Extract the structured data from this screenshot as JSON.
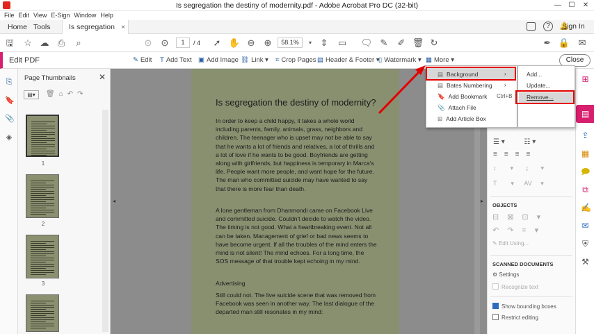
{
  "window": {
    "title": "Is segregation the destiny of modernity.pdf - Adobe Acrobat Pro DC (32-bit)",
    "minimize": "—",
    "maximize": "☐",
    "close": "✕"
  },
  "menu": [
    "File",
    "Edit",
    "View",
    "E-Sign",
    "Window",
    "Help"
  ],
  "tabs": {
    "home": "Home",
    "tools": "Tools",
    "doc": "Is segregation the ...",
    "doc_close": "×",
    "sign_in": "Sign In"
  },
  "toolbar": {
    "page_current": "1",
    "page_total": "/ 4",
    "zoom": "58.1%"
  },
  "editbar": {
    "label": "Edit PDF",
    "edit": "Edit",
    "add_text": "Add Text",
    "add_image": "Add Image",
    "link": "Link",
    "crop": "Crop Pages",
    "header_footer": "Header & Footer",
    "watermark": "Watermark",
    "more": "More",
    "close": "Close"
  },
  "thumbnails": {
    "title": "Page Thumbnails",
    "pages": [
      "1",
      "2",
      "3"
    ]
  },
  "document": {
    "title": "Is segregation the destiny of modernity?",
    "p1": "In order to keep a child happy, it takes a whole world including parents, family, animals, grass, neighbors and children. The teenager who is upset may not be able to say that he wants a lot of friends and relatives, a lot of thrills and a lot of love if he wants to be good. Boyfriends are getting along with girlfriends, but happiness is temporary in Marca's life. People want more people, and want hope for the future. The man who committed suicide may have wanted to say that there is more fear than death.",
    "p2": "A lone gentleman from Dhanmondi came on Facebook Live and committed suicide. Couldn't decide to watch the video. The timing is not good. What a heartbreaking event. Not all can be taken. Management of grief or bad news seems to have become urgent. If all the troubles of the mind enters the mind is not silent! The mind echoes. For a long time, the SOS message of that trouble kept echoing in my mind.",
    "p3": "Advertising",
    "p4": "Still could not. The live suicide scene that was removed from Facebook was seen in another way. The last dialogue of the departed man still resonates in my mind:"
  },
  "more_menu": {
    "items": [
      "Background",
      "Bates Numbering",
      "Add Bookmark",
      "Attach File",
      "Add Article Box"
    ],
    "shortcut": "Ctrl+B"
  },
  "background_submenu": {
    "items": [
      "Add...",
      "Update...",
      "Remove..."
    ]
  },
  "right_panel": {
    "objects": "OBJECTS",
    "edit_using": "Edit Using...",
    "scanned": "SCANNED DOCUMENTS",
    "settings": "Settings",
    "recognize": "Recognize text",
    "show_boxes": "Show bounding boxes",
    "restrict": "Restrict editing"
  },
  "colors": {
    "accent": "#d71f6e",
    "highlight": "#e30000",
    "page": "#899070"
  }
}
